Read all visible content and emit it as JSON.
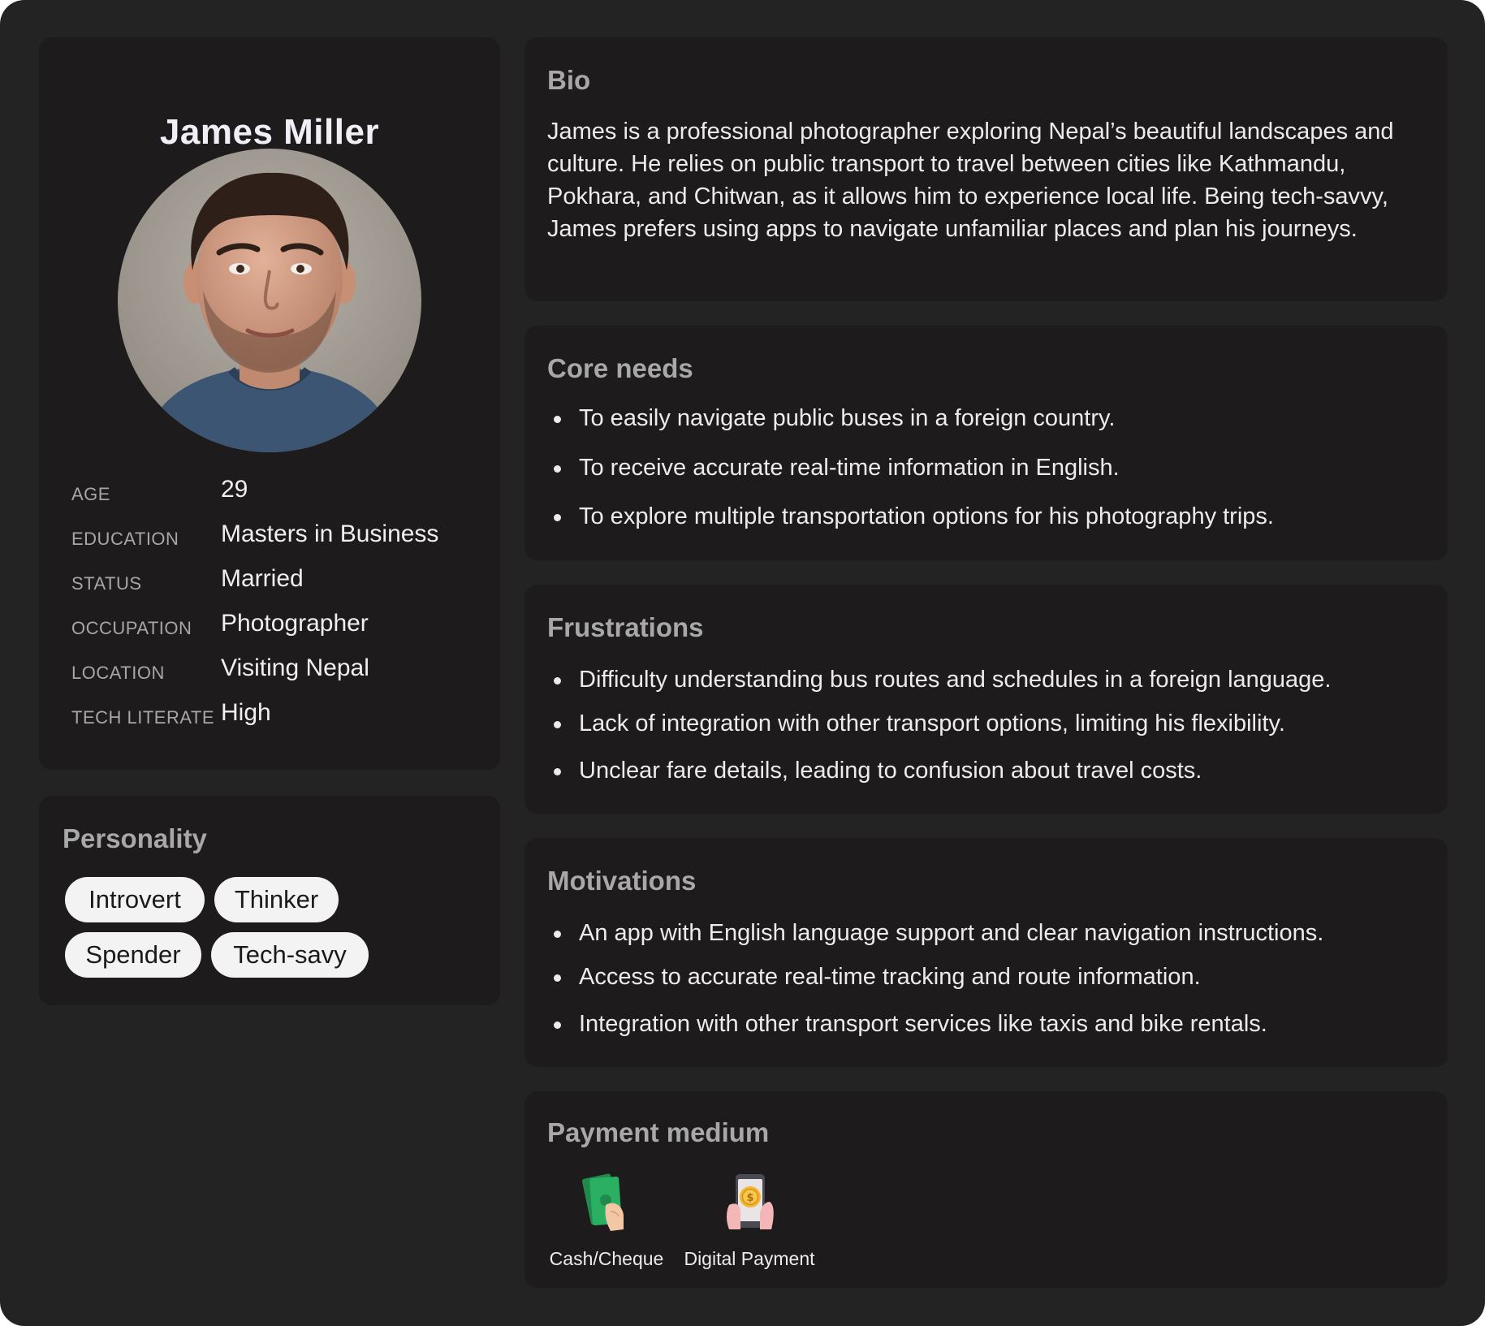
{
  "profile": {
    "name": "James Miller",
    "facts": [
      {
        "label": "AGE",
        "value": "29"
      },
      {
        "label": "EDUCATION",
        "value": "Masters in Business"
      },
      {
        "label": "STATUS",
        "value": "Married"
      },
      {
        "label": "OCCUPATION",
        "value": "Photographer"
      },
      {
        "label": "LOCATION",
        "value": "Visiting Nepal"
      },
      {
        "label": "TECH LITERATE",
        "value": "High"
      }
    ]
  },
  "personality": {
    "title": "Personality",
    "traits": [
      "Introvert",
      "Thinker",
      "Spender",
      "Tech-savy"
    ]
  },
  "bio": {
    "title": "Bio",
    "text": "James is a professional photographer exploring Nepal’s beautiful landscapes and culture. He relies on public transport to travel between cities like Kathmandu, Pokhara, and Chitwan, as it allows him to experience local life. Being tech-savvy, James prefers using apps to navigate unfamiliar places and plan his journeys."
  },
  "core_needs": {
    "title": "Core needs",
    "items": [
      "To easily navigate public buses in a foreign country.",
      "To receive accurate real-time information in English.",
      "To explore multiple transportation options for his photography trips."
    ]
  },
  "frustrations": {
    "title": "Frustrations",
    "items": [
      "Difficulty understanding bus routes and schedules in a foreign language.",
      "Lack of integration with other transport options, limiting his flexibility.",
      "Unclear fare details, leading to confusion about travel costs."
    ]
  },
  "motivations": {
    "title": "Motivations",
    "items": [
      "An app with English language support and clear navigation instructions.",
      "Access to accurate real-time tracking and route information.",
      "Integration with other transport services like taxis and bike rentals."
    ]
  },
  "payment": {
    "title": "Payment medium",
    "methods": [
      {
        "label": "Cash/Cheque",
        "icon": "cash-hand-icon"
      },
      {
        "label": "Digital Payment",
        "icon": "phone-coin-icon"
      }
    ]
  },
  "colors": {
    "background": "#232323",
    "card": "#1d1b1b",
    "chip": "#f3f3f3",
    "heading": "#a8a8a8",
    "text": "#ececec"
  }
}
